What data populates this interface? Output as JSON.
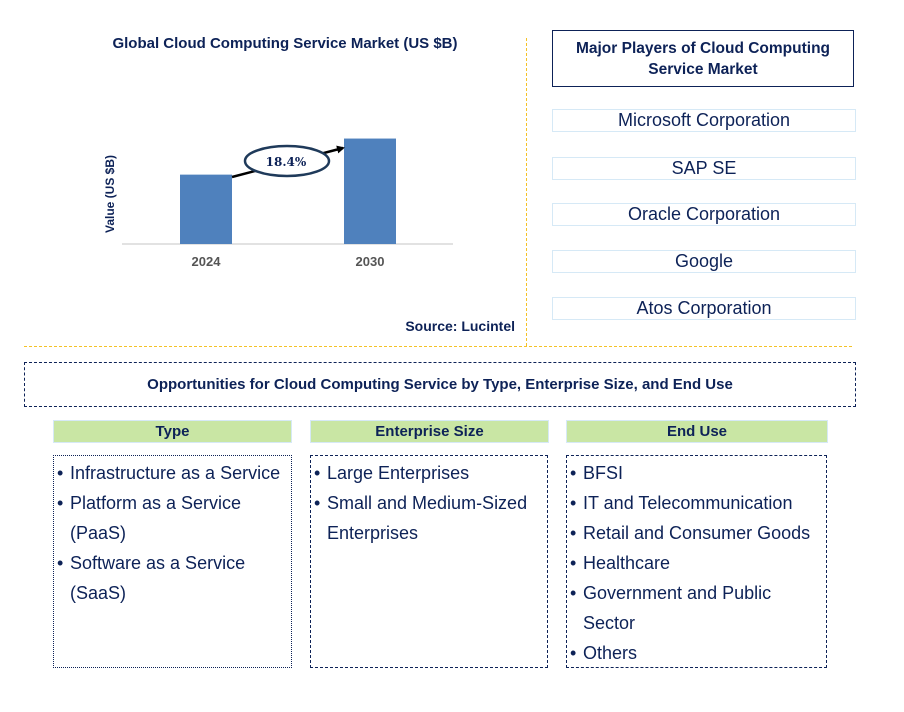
{
  "chart_data": {
    "type": "bar",
    "title": "Global Cloud Computing Service Market (US $B)",
    "xlabel": "",
    "ylabel": "Value (US $B)",
    "categories": [
      "2024",
      "2030"
    ],
    "values": [
      1.0,
      1.52
    ],
    "value_note": "No value labels or y-axis ticks shown; values are relative bar heights (2030 ≈ 1.52× 2024)",
    "ylim": [
      0,
      1.6
    ],
    "grid": false,
    "legend": "none",
    "annotations": [
      {
        "text": "18.4%",
        "meaning": "CAGR",
        "from": "2024",
        "to": "2030"
      }
    ],
    "bar_color": "#4f81bd"
  },
  "source": "Source: Lucintel",
  "players": {
    "title": "Major Players of Cloud Computing Service Market",
    "items": [
      "Microsoft Corporation",
      "SAP SE",
      "Oracle Corporation",
      "Google",
      "Atos Corporation"
    ]
  },
  "opportunities": {
    "title": "Opportunities for Cloud Computing Service by Type, Enterprise Size, and End Use",
    "columns": [
      {
        "header": "Type",
        "items": [
          "Infrastructure as a Service",
          "Platform as a Service (PaaS)",
          "Software as a Service (SaaS)"
        ]
      },
      {
        "header": "Enterprise Size",
        "items": [
          "Large Enterprises",
          "Small and Medium-Sized Enterprises"
        ]
      },
      {
        "header": "End Use",
        "items": [
          "BFSI",
          "IT and Telecommunication",
          "Retail and Consumer Goods",
          "Healthcare",
          "Government and Public Sector",
          "Others"
        ]
      }
    ]
  },
  "colors": {
    "text": "#0d2257",
    "divider": "#f5c226",
    "header_fill": "#c9e6a4",
    "player_border": "#d6e9f6"
  }
}
